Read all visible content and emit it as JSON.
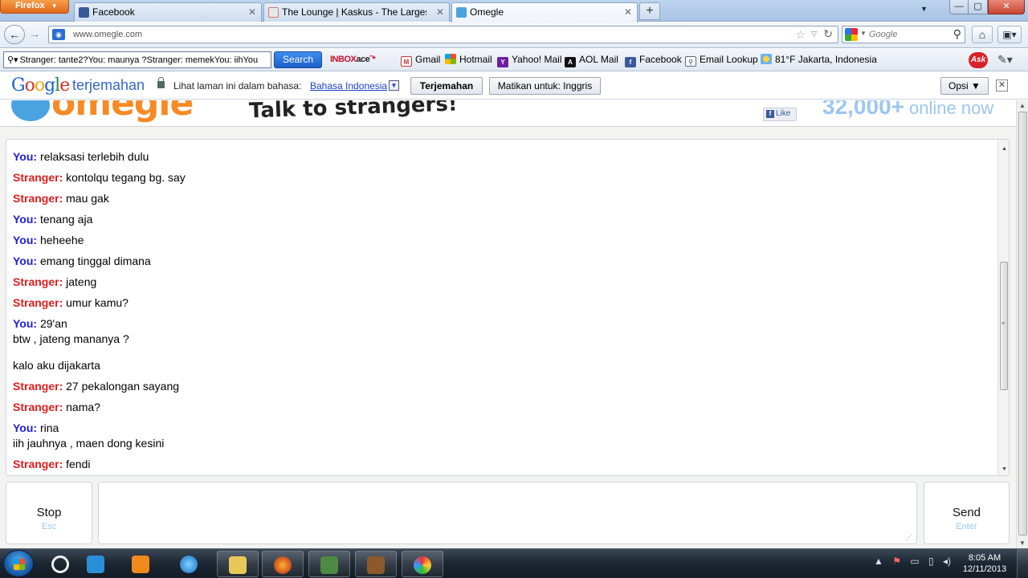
{
  "browser": {
    "menu_button": "Firefox",
    "tabs": [
      {
        "title": "Facebook",
        "icon": "facebook-icon"
      },
      {
        "title": "The Lounge | Kaskus - The Largest In...",
        "icon": "kaskus-icon"
      },
      {
        "title": "Omegle",
        "icon": "omegle-icon"
      }
    ],
    "url": "www.omegle.com",
    "search_placeholder": "Google"
  },
  "ask_toolbar": {
    "query": "Stranger: tante2?You: maunya ?Stranger: memekYou: iihYou",
    "search_button": "Search",
    "inbox_brand_1": "INBOX",
    "inbox_brand_2": "ace",
    "bookmarks": [
      "Gmail",
      "Hotmail",
      "Yahoo! Mail",
      "AOL Mail",
      "Facebook",
      "Email Lookup",
      "81°F Jakarta, Indonesia"
    ],
    "ask_label": "Ask"
  },
  "translate_bar": {
    "logo": "Google",
    "product": "terjemahan",
    "prompt": "Lihat laman ini dalam bahasa:",
    "language": "Bahasa Indonesia",
    "translate_button": "Terjemahan",
    "disable_button": "Matikan untuk: Inggris",
    "options_button": "Opsi ▼"
  },
  "page": {
    "logo": "omegle",
    "tagline": "Talk to strangers!",
    "like_label": "Like",
    "online_count": "32,000+",
    "online_label": "online now",
    "messages": [
      {
        "who": "You:",
        "role": "you",
        "text": "relaksasi terlebih dulu"
      },
      {
        "who": "Stranger:",
        "role": "stranger",
        "text": "kontolqu tegang bg. say"
      },
      {
        "who": "Stranger:",
        "role": "stranger",
        "text": "mau gak"
      },
      {
        "who": "You:",
        "role": "you",
        "text": "tenang aja"
      },
      {
        "who": "You:",
        "role": "you",
        "text": "heheehe"
      },
      {
        "who": "You:",
        "role": "you",
        "text": "emang tinggal dimana"
      },
      {
        "who": "Stranger:",
        "role": "stranger",
        "text": "jateng"
      },
      {
        "who": "Stranger:",
        "role": "stranger",
        "text": "umur kamu?"
      },
      {
        "who": "You:",
        "role": "you",
        "text": "29'an",
        "extra": [
          "btw , jateng mananya ?",
          "kalo aku dijakarta"
        ]
      },
      {
        "who": "Stranger:",
        "role": "stranger",
        "text": "27 pekalongan sayang"
      },
      {
        "who": "Stranger:",
        "role": "stranger",
        "text": "nama?"
      },
      {
        "who": "You:",
        "role": "you",
        "text": "rina",
        "extra": [
          "iih jauhnya , maen dong kesini"
        ]
      },
      {
        "who": "Stranger:",
        "role": "stranger",
        "text": "fendi"
      }
    ],
    "stop_label": "Stop",
    "stop_hint": "Esc",
    "send_label": "Send",
    "send_hint": "Enter"
  },
  "taskbar": {
    "time": "8:05 AM",
    "date": "12/11/2013"
  },
  "colors": {
    "you": "#1d1de0",
    "stranger": "#e01c1c",
    "omegle_orange": "#f68a25",
    "online_blue": "#9cc6ee"
  }
}
